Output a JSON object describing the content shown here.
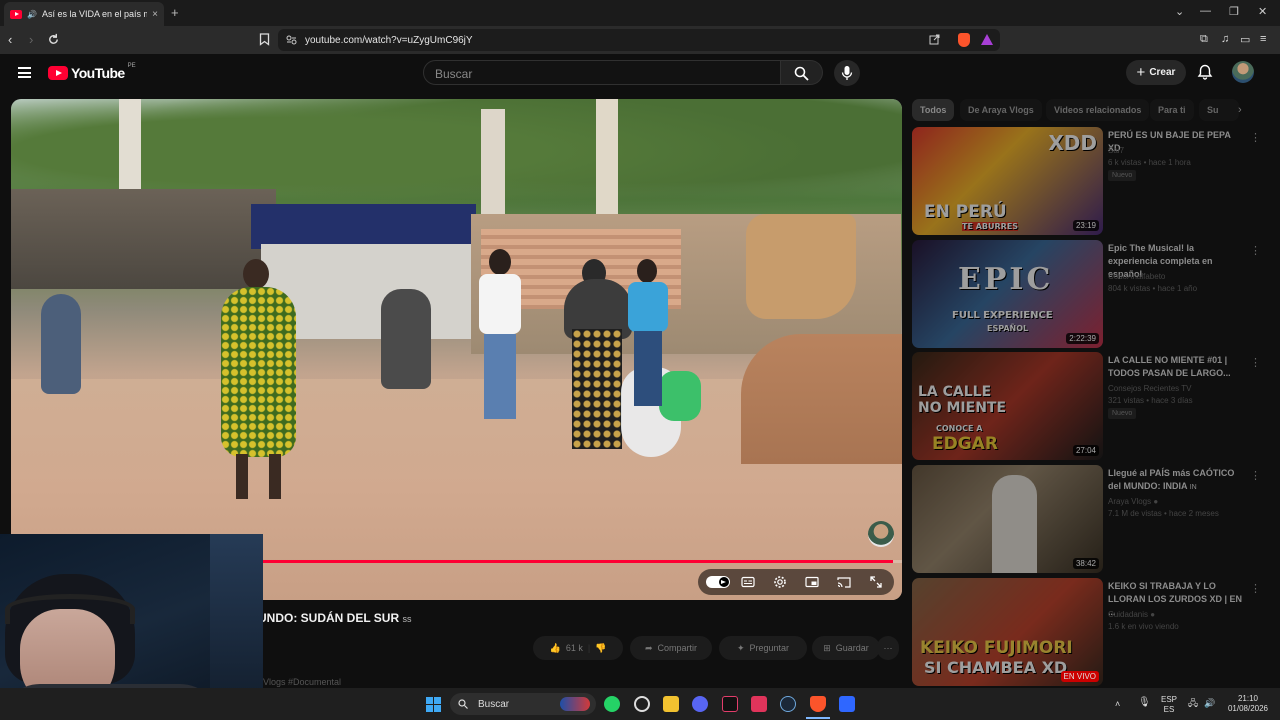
{
  "browser": {
    "tab_title": "Así es la VIDA en el país más",
    "tab_close": "×",
    "new_tab": "+",
    "url": "youtube.com/watch?v=uZygUmC96jY",
    "window_controls": [
      "⌄",
      "—",
      "❐",
      "✕"
    ]
  },
  "youtube": {
    "logo_text": "YouTube",
    "country_code": "PE",
    "search_placeholder": "Buscar",
    "create_label": "Crear"
  },
  "video": {
    "progress_fraction": 0.99,
    "title": "UNDO: SUDÁN DEL SUR",
    "title_suffix": "ss",
    "likes": "61 k",
    "share_label": "Compartir",
    "ask_label": "Preguntar",
    "save_label": "Guardar",
    "hashtags": "aVlogs #Documental"
  },
  "sidebar": {
    "chips": [
      "Todos",
      "De Araya Vlogs",
      "Videos relacionados",
      "Para ti",
      "Su"
    ],
    "recommendations": [
      {
        "title": "PERÚ ES UN BAJE DE PEPA XD",
        "channel": "Sal7",
        "meta": "6 k vistas • hace 1 hora",
        "badge": "Nuevo",
        "duration": "23:19",
        "thumb_text_top": "XDD",
        "thumb_text_main": "EN PERÚ",
        "thumb_text_sub": "TE ABURRES"
      },
      {
        "title": "Epic The Musical! la experiencia completa en español",
        "channel": "CodoAnalfabeto",
        "meta": "804 k vistas • hace 1 año",
        "badge": "",
        "duration": "2:22:39",
        "thumb_text_top": "EPIC",
        "thumb_text_main": "FULL EXPERIENCE",
        "thumb_text_sub": "ESPAÑOL"
      },
      {
        "title": "LA CALLE NO MIENTE #01 | TODOS PASAN DE LARGO...",
        "channel": "Consejos Recientes TV",
        "meta": "321 vistas • hace 3 días",
        "badge": "Nuevo",
        "duration": "27:04",
        "thumb_text_top": "LA CALLE NO MIENTE",
        "thumb_text_main": "EDGAR",
        "thumb_text_sub": "CONOCE A"
      },
      {
        "title": "Llegué al PAÍS más CAÓTICO del MUNDO: INDIA",
        "title_suffix": "IN",
        "channel": "Araya Vlogs",
        "meta": "7.1 M de vistas • hace 2 meses",
        "badge": "",
        "duration": "38:42",
        "thumb_text_top": "",
        "thumb_text_main": "",
        "thumb_text_sub": ""
      },
      {
        "title": "KEIKO SI TRABAJA Y LO LLORAN LOS ZURDOS XD | EN ...",
        "channel": "Cuidadanis",
        "meta": "1.6 k en vivo viendo",
        "badge": "EN VIVO",
        "duration": "",
        "thumb_text_top": "KEIKO FUJIMORI",
        "thumb_text_main": "SI CHAMBEA XD",
        "thumb_text_sub": ""
      }
    ]
  },
  "taskbar": {
    "search_label": "Buscar",
    "lang_top": "ESP",
    "lang_bottom": "ES",
    "time": "21:10",
    "date": "01/08/2026"
  },
  "colors": {
    "yt_red": "#ff0033",
    "background": "#0f0f0f",
    "windows_blue": "#3fa9f5"
  }
}
